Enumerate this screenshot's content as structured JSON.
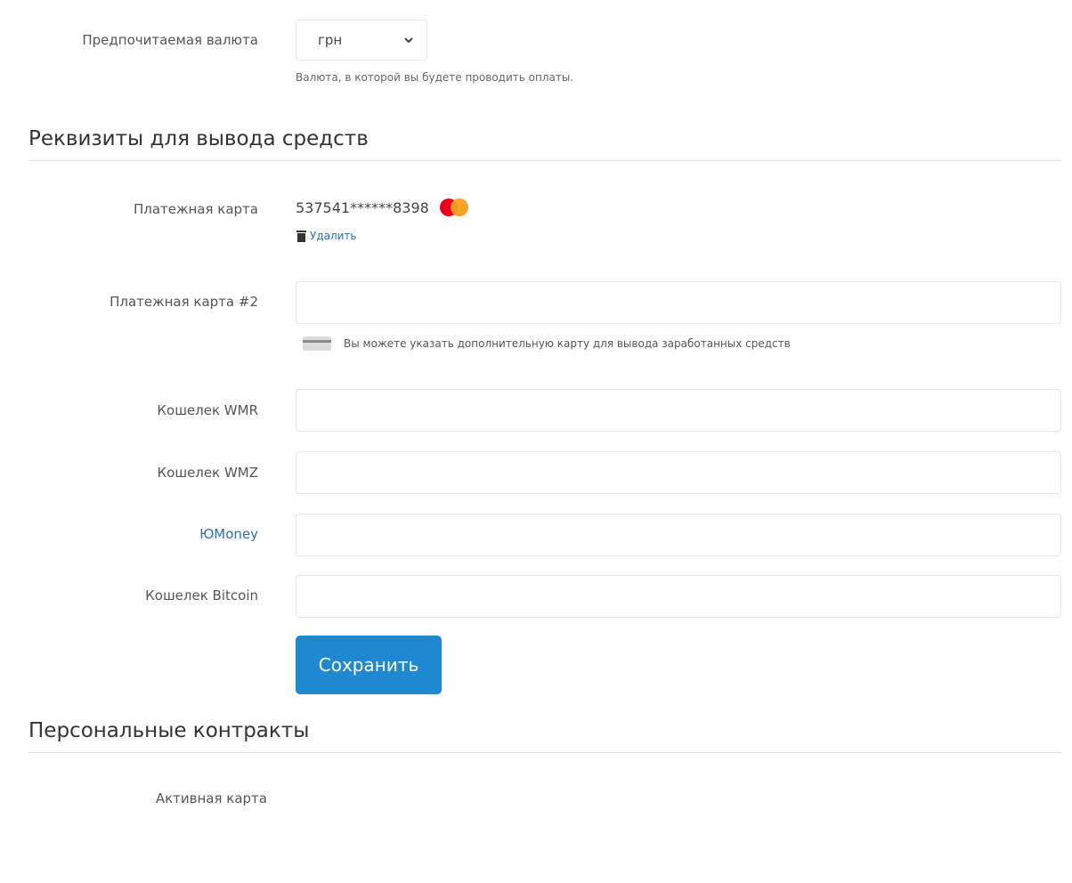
{
  "currency": {
    "label": "Предпочитаемая валюта",
    "selected": "грн",
    "help": "Валюта, в которой вы будете проводить оплаты."
  },
  "withdrawal": {
    "title": "Реквизиты для вывода средств",
    "card": {
      "label": "Платежная карта",
      "number": "537541******8398",
      "brand_icon": "mastercard-icon",
      "delete_label": "Удалить"
    },
    "card2": {
      "label": "Платежная карта #2",
      "value": "",
      "hint": "Вы можете указать дополнительную карту для вывода заработанных средств"
    },
    "wmr": {
      "label": "Кошелек WMR",
      "value": ""
    },
    "wmz": {
      "label": "Кошелек WMZ",
      "value": ""
    },
    "yumoney": {
      "label": "ЮMoney",
      "value": ""
    },
    "bitcoin": {
      "label": "Кошелек Bitcoin",
      "value": ""
    },
    "save_label": "Сохранить"
  },
  "contracts": {
    "title": "Персональные контракты",
    "active_card_label": "Активная карта"
  },
  "colors": {
    "primary_button": "#1e88d0",
    "link": "#2a6fb5",
    "mastercard_red": "#eb001b",
    "mastercard_orange": "#f79e1b"
  }
}
